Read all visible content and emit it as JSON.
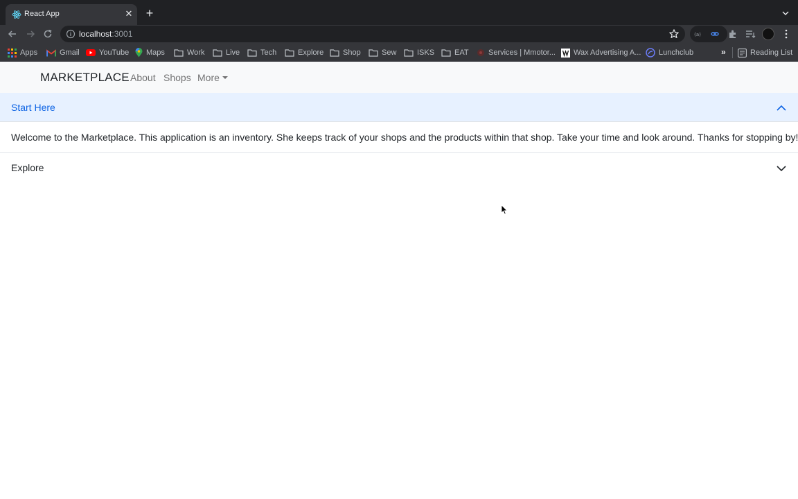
{
  "browser": {
    "tab_title": "React App",
    "url_host": "localhost",
    "url_port": ":3001",
    "accent_color": "#8ab4f8",
    "bookmarks": [
      {
        "label": "Apps",
        "icon": "apps-grid-icon"
      },
      {
        "label": "Gmail",
        "icon": "gmail-icon"
      },
      {
        "label": "YouTube",
        "icon": "youtube-icon"
      },
      {
        "label": "Maps",
        "icon": "maps-pin-icon"
      },
      {
        "label": "Work",
        "icon": "folder-icon"
      },
      {
        "label": "Live",
        "icon": "folder-icon"
      },
      {
        "label": "Tech",
        "icon": "folder-icon"
      },
      {
        "label": "Explore",
        "icon": "folder-icon"
      },
      {
        "label": "Shop",
        "icon": "folder-icon"
      },
      {
        "label": "Sew",
        "icon": "folder-icon"
      },
      {
        "label": "ISKS",
        "icon": "folder-icon"
      },
      {
        "label": "EAT",
        "icon": "folder-icon"
      },
      {
        "label": "Services | Mmotor...",
        "icon": "site-favicon-icon"
      },
      {
        "label": "Wax Advertising A...",
        "icon": "wax-favicon-icon"
      },
      {
        "label": "Lunchclub",
        "icon": "lunchclub-icon"
      }
    ],
    "bookmarks_overflow": "»",
    "reading_list": "Reading List"
  },
  "navbar": {
    "brand": "MARKETPLACE",
    "links": [
      "About",
      "Shops",
      "More"
    ]
  },
  "accordion": {
    "items": [
      {
        "title": "Start Here",
        "expanded": true,
        "body": "Welcome to the Marketplace. This application is an inventory. She keeps track of your shops and the products within that shop. Take your time and look around. Thanks for stopping by!"
      },
      {
        "title": "Explore",
        "expanded": false
      }
    ],
    "active_header_bg": "#e7f1ff",
    "active_title_color": "#0c63e4"
  }
}
